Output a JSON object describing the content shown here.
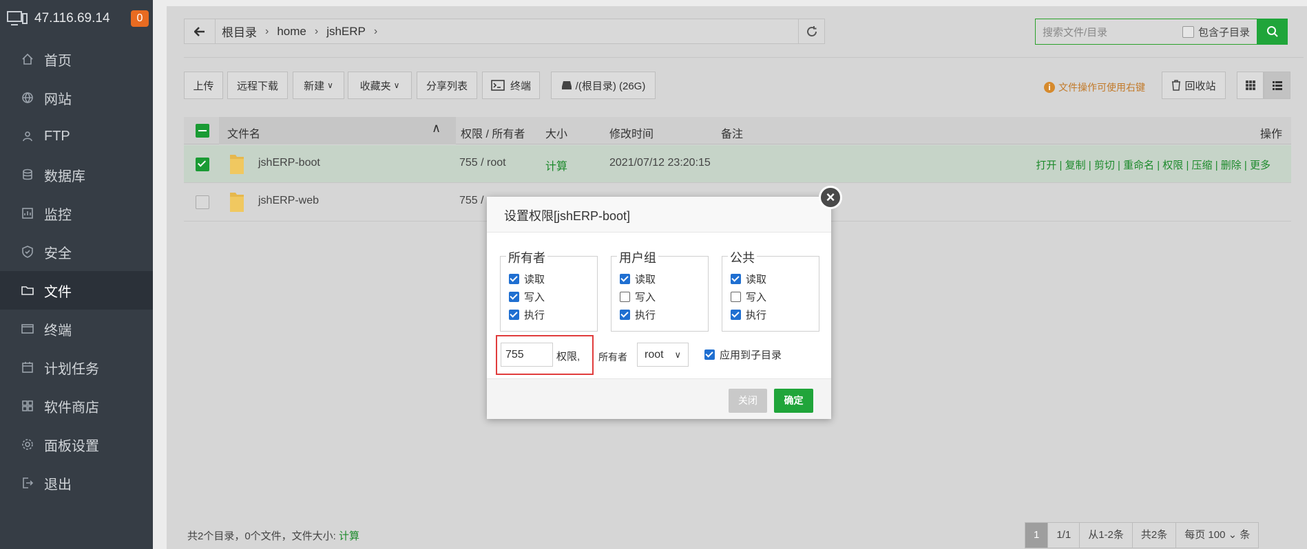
{
  "sidebar": {
    "server_ip": "47.116.69.14",
    "badge": "0",
    "items": [
      {
        "label": "首页",
        "icon": "home-icon"
      },
      {
        "label": "网站",
        "icon": "globe-icon"
      },
      {
        "label": "FTP",
        "icon": "ftp-icon"
      },
      {
        "label": "数据库",
        "icon": "database-icon"
      },
      {
        "label": "监控",
        "icon": "monitor-icon"
      },
      {
        "label": "安全",
        "icon": "shield-icon"
      },
      {
        "label": "文件",
        "icon": "folder-icon"
      },
      {
        "label": "终端",
        "icon": "terminal-icon"
      },
      {
        "label": "计划任务",
        "icon": "calendar-icon"
      },
      {
        "label": "软件商店",
        "icon": "apps-icon"
      },
      {
        "label": "面板设置",
        "icon": "gear-icon"
      },
      {
        "label": "退出",
        "icon": "logout-icon"
      }
    ],
    "active_index": 6
  },
  "path": {
    "crumbs": [
      "根目录",
      "home",
      "jshERP"
    ]
  },
  "search": {
    "placeholder": "搜索文件/目录",
    "include_sub": "包含子目录"
  },
  "toolbar": {
    "upload": "上传",
    "remote_download": "远程下载",
    "new": "新建",
    "favorites": "收藏夹",
    "share_list": "分享列表",
    "terminal": "终端",
    "disk": "/(根目录) (26G)",
    "hint": "文件操作可使用右键",
    "recycle": "回收站"
  },
  "table": {
    "headers": {
      "name": "文件名",
      "perm": "权限 / 所有者",
      "size": "大小",
      "mtime": "修改时间",
      "note": "备注",
      "ops": "操作"
    },
    "rows": [
      {
        "name": "jshERP-boot",
        "perm": "755 / root",
        "size": "计算",
        "mtime": "2021/07/12 23:20:15",
        "selected": true
      },
      {
        "name": "jshERP-web",
        "perm": "755 / ",
        "size": "",
        "mtime": "",
        "selected": false
      }
    ],
    "ops": "打开 | 复制 | 剪切 | 重命名 | 权限 | 压缩 | 删除 | 更多"
  },
  "footer": {
    "summary": "共2个目录，0个文件，文件大小:",
    "calc": "计算",
    "pager": {
      "current": "1",
      "pages": "1/1",
      "range": "从1-2条",
      "total": "共2条",
      "per_page_label": "每页",
      "per_page": "100",
      "unit": "条"
    }
  },
  "dialog": {
    "title": "设置权限[jshERP-boot]",
    "groups": [
      {
        "legend": "所有者",
        "read": "读取",
        "write": "写入",
        "exec": "执行",
        "read_on": true,
        "write_on": true,
        "exec_on": true
      },
      {
        "legend": "用户组",
        "read": "读取",
        "write": "写入",
        "exec": "执行",
        "read_on": true,
        "write_on": false,
        "exec_on": true
      },
      {
        "legend": "公共",
        "read": "读取",
        "write": "写入",
        "exec": "执行",
        "read_on": true,
        "write_on": false,
        "exec_on": true
      }
    ],
    "perm_value": "755",
    "perm_label": "权限,",
    "owner_label": "所有者",
    "owner_value": "root",
    "apply_sub": "应用到子目录",
    "btn_close": "关闭",
    "btn_ok": "确定"
  }
}
